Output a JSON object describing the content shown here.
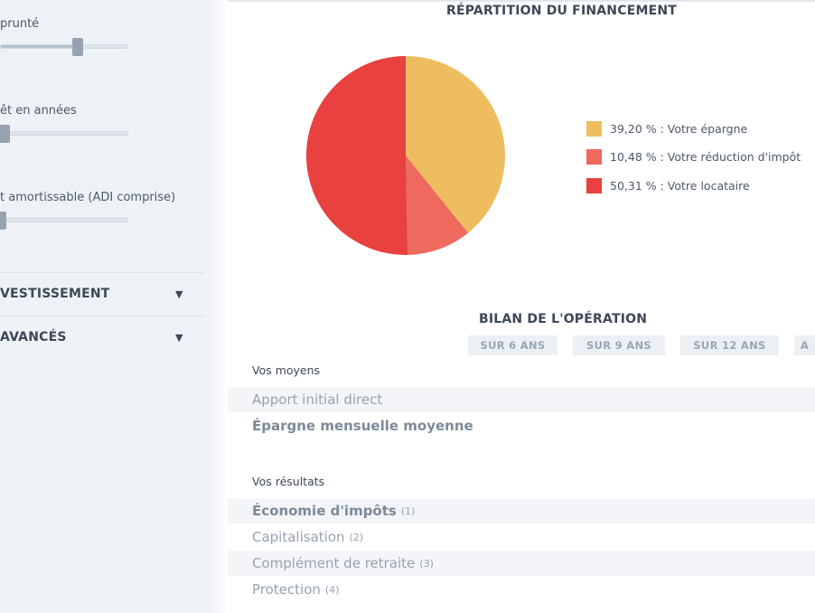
{
  "sidebar": {
    "sliders": [
      {
        "label": "prunté",
        "value_fraction": 0.6
      },
      {
        "label": "êt en années",
        "value_fraction": 0.03
      },
      {
        "label": "t amortissable (ADI comprise)",
        "value_fraction": 0.0
      }
    ],
    "sections": [
      {
        "label": "VESTISSEMENT",
        "caret": "▼"
      },
      {
        "label": "AVANCÉS",
        "caret": "▼"
      }
    ]
  },
  "financing": {
    "title": "RÉPARTITION DU FINANCEMENT",
    "legend": [
      {
        "label": "39,20 % : Votre épargne",
        "color": "#eebd5f"
      },
      {
        "label": "10,48 % : Votre réduction d'impôt",
        "color": "#ee6a5e"
      },
      {
        "label": "50,31 % : Votre locataire",
        "color": "#e8413f"
      }
    ]
  },
  "chart_data": {
    "type": "pie",
    "title": "RÉPARTITION DU FINANCEMENT",
    "labels": [
      "Votre épargne",
      "Votre réduction d'impôt",
      "Votre locataire"
    ],
    "values": [
      39.2,
      10.48,
      50.31
    ],
    "colors": [
      "#eebd5f",
      "#ee6a5e",
      "#e8413f"
    ],
    "start_angle_deg": 0,
    "direction": "clockwise",
    "legend_position": "right"
  },
  "bilan": {
    "title": "BILAN DE L'OPÉRATION",
    "tabs": [
      {
        "label": "SUR 6 ANS",
        "active": false
      },
      {
        "label": "SUR 9 ANS",
        "active": false
      },
      {
        "label": "SUR 12 ANS",
        "active": true
      },
      {
        "label": "A",
        "active": false
      }
    ],
    "moyens": {
      "heading": "Vos moyens",
      "rows": [
        {
          "label": "Apport initial direct",
          "note": ""
        },
        {
          "label": "Épargne mensuelle moyenne",
          "note": ""
        }
      ]
    },
    "resultats": {
      "heading": "Vos résultats",
      "rows": [
        {
          "label": "Économie d'impôts",
          "note": "(1)"
        },
        {
          "label": "Capitalisation",
          "note": "(2)"
        },
        {
          "label": "Complément de retraite",
          "note": "(3)"
        },
        {
          "label": "Protection",
          "note": "(4)"
        }
      ]
    }
  }
}
